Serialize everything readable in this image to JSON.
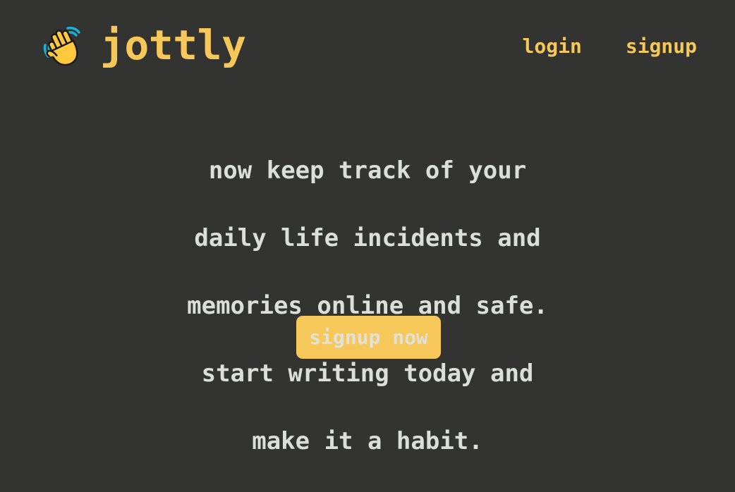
{
  "header": {
    "logo_icon": "waving-hand-icon",
    "brand": "jottly",
    "nav": {
      "login": "login",
      "signup": "signup"
    }
  },
  "hero": {
    "lines": [
      "now keep track of your",
      "daily life incidents and",
      "memories online and safe.",
      "start writing today and",
      "make it a habit."
    ]
  },
  "cta": {
    "label": "signup now"
  },
  "colors": {
    "background": "#333432",
    "accent": "#f6c759",
    "text": "#dcdfd9"
  }
}
